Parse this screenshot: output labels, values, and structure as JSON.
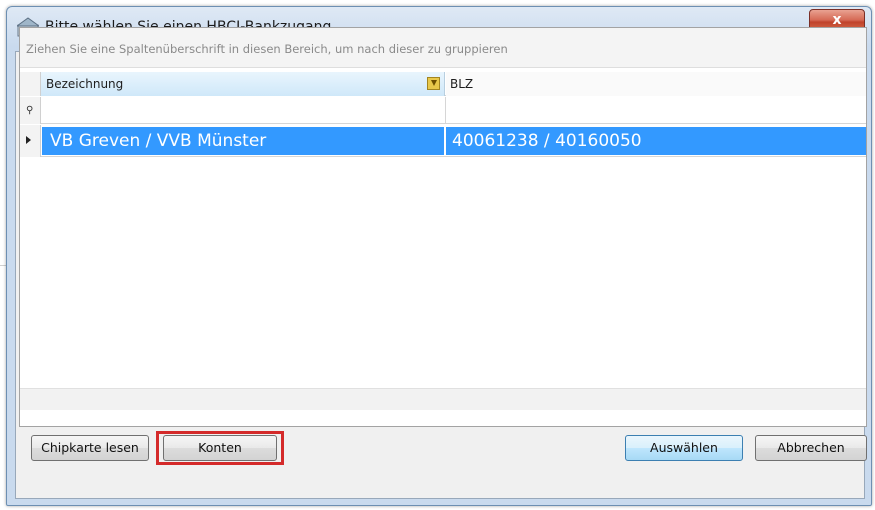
{
  "window": {
    "title": "Bitte wählen Sie einen HBCI-Bankzugang",
    "close_label": "x"
  },
  "grid": {
    "group_hint": "Ziehen Sie eine Spaltenüberschrift in diesen Bereich, um nach dieser zu gruppieren",
    "columns": [
      "Bezeichnung",
      "BLZ"
    ],
    "rows": [
      {
        "bezeichnung": "VB Greven / VVB Münster",
        "blz": "40061238 / 40160050",
        "selected": true
      }
    ]
  },
  "buttons": {
    "chipkarte": "Chipkarte lesen",
    "konten": "Konten",
    "auswaehlen": "Auswählen",
    "abbrechen": "Abbrechen"
  },
  "colors": {
    "selection": "#3399ff",
    "highlight_box": "#d42a2a"
  },
  "icons": {
    "title": "bank-icon",
    "filter": "filter-icon",
    "filter_row": "pin-icon",
    "current_row": "row-arrow-icon"
  }
}
